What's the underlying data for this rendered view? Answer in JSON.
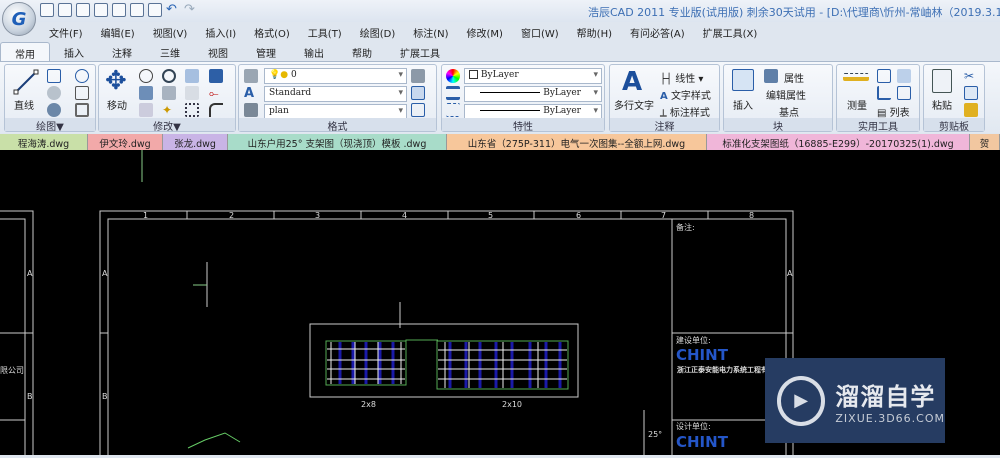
{
  "app": {
    "title": "浩辰CAD 2011 专业版(试用版) 刺余30天试用 - [D:\\代理商\\忻州-常岫林（2019.3.15"
  },
  "menu": [
    "文件(F)",
    "编辑(E)",
    "视图(V)",
    "插入(I)",
    "格式(O)",
    "工具(T)",
    "绘图(D)",
    "标注(N)",
    "修改(M)",
    "窗口(W)",
    "帮助(H)",
    "有问必答(A)",
    "扩展工具(X)"
  ],
  "tabs": [
    "常用",
    "插入",
    "注释",
    "三维",
    "视图",
    "管理",
    "输出",
    "帮助",
    "扩展工具"
  ],
  "ribbon": {
    "draw": {
      "label": "绘图▼",
      "line": "直线"
    },
    "modify": {
      "label": "修改▼",
      "move": "移动"
    },
    "format": {
      "label": "格式",
      "layer": "0",
      "textstyle": "Standard",
      "dimstyle": "plan"
    },
    "props": {
      "label": "特性",
      "color": "ByLayer",
      "linetype": "ByLayer",
      "lineweight": "ByLayer"
    },
    "annot": {
      "label": "注释",
      "mtext": "多行文字",
      "linear": "线性",
      "textstyle": "文字样式",
      "dimstyle": "标注样式"
    },
    "block": {
      "label": "块",
      "insert": "插入",
      "attr": "属性",
      "editattr": "编辑属性",
      "base": "基点"
    },
    "util": {
      "label": "实用工具",
      "measure": "测量",
      "list": "列表"
    },
    "clip": {
      "label": "剪贴板",
      "paste": "粘贴"
    }
  },
  "files": [
    {
      "name": "程海涛.dwg",
      "color": "#c9e0a8"
    },
    {
      "name": "伊文玲.dwg",
      "color": "#f2a9a9"
    },
    {
      "name": "张龙.dwg",
      "color": "#c9b4e6"
    },
    {
      "name": "山东户用25° 支架图（现浇顶）模板 .dwg",
      "color": "#a8dcc9"
    },
    {
      "name": "山东省（275P-311）电气一次图集--全额上网.dwg",
      "color": "#f7c79b"
    },
    {
      "name": "标准化支架图纸（16885-E299）-20170325(1).dwg",
      "color": "#f0b6d9"
    },
    {
      "name": "贺",
      "color": "#f2c7a0"
    }
  ],
  "drawing": {
    "cols": [
      "1",
      "2",
      "3",
      "4",
      "5",
      "6",
      "7",
      "8"
    ],
    "rows": [
      "A",
      "B"
    ],
    "label_left": "2x8",
    "label_right": "2x10",
    "angle": "25°",
    "company_left": "限公司",
    "notes": "备注:",
    "unit1": "建设单位:",
    "unit2": "设计单位:",
    "brand": "CHINT",
    "company": "浙江正泰安能电力系统工程有限"
  },
  "watermark": {
    "title": "溜溜自学",
    "url": "ZIXUE.3D66.COM"
  }
}
